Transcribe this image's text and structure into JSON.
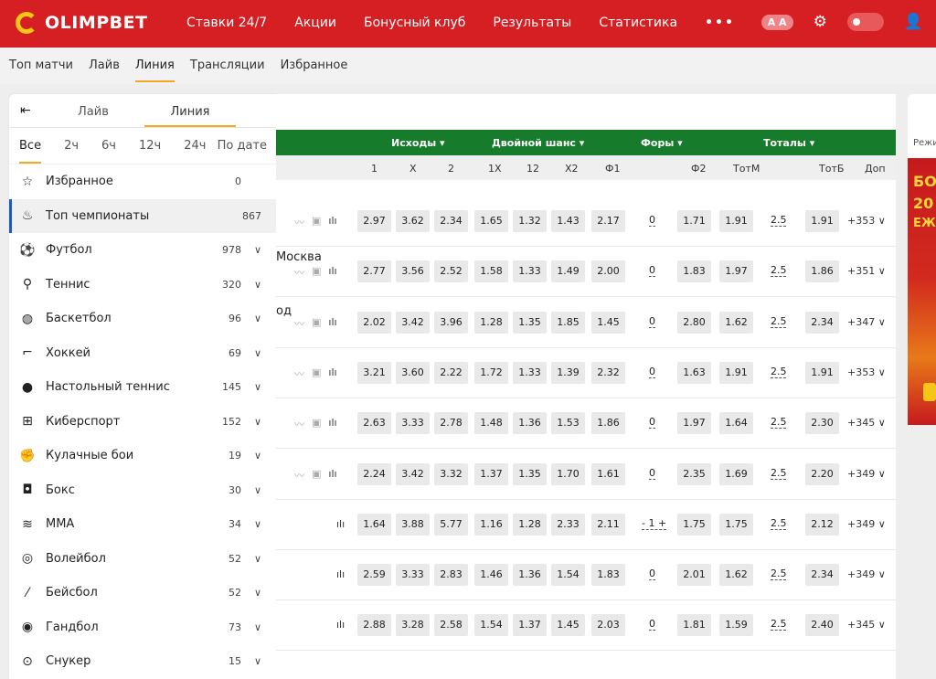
{
  "brand": {
    "name": "OLIMPBET"
  },
  "nav": [
    "Ставки 24/7",
    "Акции",
    "Бонусный клуб",
    "Результаты",
    "Статистика",
    "•••"
  ],
  "font_toggle": "A A",
  "subnav": [
    "Топ матчи",
    "Лайв",
    "Линия",
    "Трансляции",
    "Избранное"
  ],
  "sidebar": {
    "tabs": [
      "Лайв",
      "Линия"
    ],
    "periods": [
      "Все",
      "2ч",
      "6ч",
      "12ч",
      "24ч",
      "По дате"
    ],
    "items": [
      {
        "icon": "☆",
        "label": "Избранное",
        "count": "0"
      },
      {
        "icon": "♨",
        "label": "Топ чемпионаты",
        "count": "867"
      },
      {
        "icon": "⚽",
        "label": "Футбол",
        "count": "978"
      },
      {
        "icon": "⚲",
        "label": "Теннис",
        "count": "320"
      },
      {
        "icon": "◍",
        "label": "Баскетбол",
        "count": "96"
      },
      {
        "icon": "⌐",
        "label": "Хоккей",
        "count": "69"
      },
      {
        "icon": "●",
        "label": "Настольный теннис",
        "count": "145"
      },
      {
        "icon": "⊞",
        "label": "Киберспорт",
        "count": "152"
      },
      {
        "icon": "✊",
        "label": "Кулачные бои",
        "count": "19"
      },
      {
        "icon": "◘",
        "label": "Бокс",
        "count": "30"
      },
      {
        "icon": "≋",
        "label": "ММА",
        "count": "34"
      },
      {
        "icon": "◎",
        "label": "Волейбол",
        "count": "52"
      },
      {
        "icon": "⁄",
        "label": "Бейсбол",
        "count": "52"
      },
      {
        "icon": "◉",
        "label": "Гандбол",
        "count": "73"
      },
      {
        "icon": "⊙",
        "label": "Снукер",
        "count": "15"
      }
    ]
  },
  "groups": [
    "Исходы ▾",
    "Двойной шанс ▾",
    "Форы ▾",
    "Тоталы ▾"
  ],
  "columns": [
    "1",
    "X",
    "2",
    "1X",
    "12",
    "X2",
    "Ф1",
    "Ф2",
    "ТотМ",
    "ТотБ",
    "Доп"
  ],
  "rows": [
    {
      "text": "",
      "o": [
        "2.97",
        "3.62",
        "2.34",
        "1.65",
        "1.32",
        "1.43",
        "2.17",
        "1.71",
        "1.91",
        "1.91"
      ],
      "h": "0",
      "t": "2.5",
      "dop": "+353"
    },
    {
      "text": "Москва",
      "o": [
        "2.77",
        "3.56",
        "2.52",
        "1.58",
        "1.33",
        "1.49",
        "2.00",
        "1.83",
        "1.97",
        "1.86"
      ],
      "h": "0",
      "t": "2.5",
      "dop": "+351"
    },
    {
      "text": "од",
      "o": [
        "2.02",
        "3.42",
        "3.96",
        "1.28",
        "1.35",
        "1.85",
        "1.45",
        "2.80",
        "1.62",
        "2.34"
      ],
      "h": "0",
      "t": "2.5",
      "dop": "+347"
    },
    {
      "text": "",
      "o": [
        "3.21",
        "3.60",
        "2.22",
        "1.72",
        "1.33",
        "1.39",
        "2.32",
        "1.63",
        "1.91",
        "1.91"
      ],
      "h": "0",
      "t": "2.5",
      "dop": "+353"
    },
    {
      "text": "",
      "o": [
        "2.63",
        "3.33",
        "2.78",
        "1.48",
        "1.36",
        "1.53",
        "1.86",
        "1.97",
        "1.64",
        "2.30"
      ],
      "h": "0",
      "t": "2.5",
      "dop": "+345"
    },
    {
      "text": "",
      "o": [
        "2.24",
        "3.42",
        "3.32",
        "1.37",
        "1.35",
        "1.70",
        "1.61",
        "2.35",
        "1.69",
        "2.20"
      ],
      "h": "0",
      "t": "2.5",
      "dop": "+349"
    },
    {
      "text": "",
      "o": [
        "1.64",
        "3.88",
        "5.77",
        "1.16",
        "1.28",
        "2.33",
        "2.11",
        "1.75",
        "1.75",
        "2.12"
      ],
      "h": "- 1 +",
      "t": "2.5",
      "dop": "+349"
    },
    {
      "text": "",
      "o": [
        "2.59",
        "3.33",
        "2.83",
        "1.46",
        "1.36",
        "1.54",
        "1.83",
        "2.01",
        "1.62",
        "2.34"
      ],
      "h": "0",
      "t": "2.5",
      "dop": "+349"
    },
    {
      "text": "",
      "o": [
        "2.88",
        "3.28",
        "2.58",
        "1.54",
        "1.37",
        "1.45",
        "2.03",
        "1.81",
        "1.59",
        "2.40"
      ],
      "h": "0",
      "t": "2.5",
      "dop": "+345"
    }
  ],
  "right": {
    "label": "Режи",
    "banner": [
      "БОН",
      "20",
      "ЕЖЕ"
    ]
  }
}
